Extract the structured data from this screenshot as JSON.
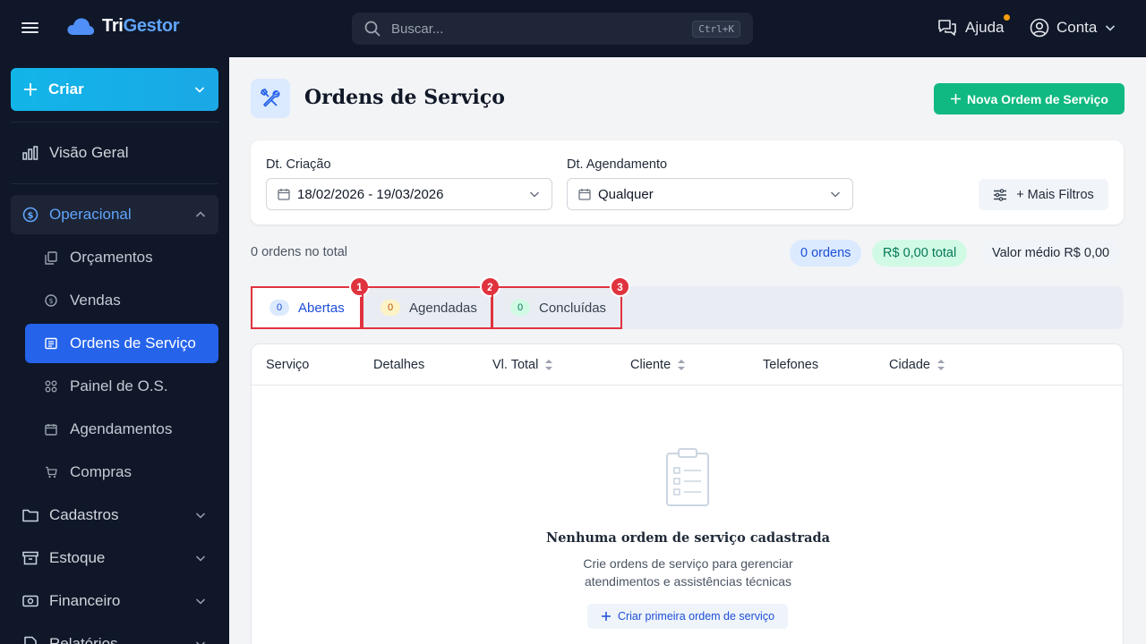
{
  "app": {
    "name_part1": "Tri",
    "name_part2": "Gestor"
  },
  "topbar": {
    "search_placeholder": "Buscar...",
    "search_shortcut": "Ctrl+K",
    "help_label": "Ajuda",
    "account_label": "Conta"
  },
  "sidebar": {
    "create_label": "Criar",
    "overview_label": "Visão Geral",
    "operational_label": "Operacional",
    "sub_items": [
      {
        "label": "Orçamentos"
      },
      {
        "label": "Vendas"
      },
      {
        "label": "Ordens de Serviço"
      },
      {
        "label": "Painel de O.S."
      },
      {
        "label": "Agendamentos"
      },
      {
        "label": "Compras"
      }
    ],
    "groups": [
      {
        "label": "Cadastros"
      },
      {
        "label": "Estoque"
      },
      {
        "label": "Financeiro"
      },
      {
        "label": "Relatórios"
      }
    ]
  },
  "page": {
    "title": "Ordens de Serviço",
    "new_button": "Nova Ordem de Serviço"
  },
  "filters": {
    "created_label": "Dt. Criação",
    "created_value": "18/02/2026 - 19/03/2026",
    "scheduled_label": "Dt. Agendamento",
    "scheduled_value": "Qualquer",
    "more_filters": "+ Mais Filtros"
  },
  "summary": {
    "total_text": "0 ordens no total",
    "orders_pill": "0 ordens",
    "total_pill": "R$ 0,00 total",
    "average_pill": "Valor médio R$ 0,00"
  },
  "tabs": [
    {
      "count": "0",
      "label": "Abertas",
      "badge": "1"
    },
    {
      "count": "0",
      "label": "Agendadas",
      "badge": "2"
    },
    {
      "count": "0",
      "label": "Concluídas",
      "badge": "3"
    }
  ],
  "table": {
    "columns": [
      "Serviço",
      "Detalhes",
      "Vl. Total",
      "Cliente",
      "Telefones",
      "Cidade"
    ]
  },
  "empty": {
    "title": "Nenhuma ordem de serviço cadastrada",
    "desc_line1": "Crie ordens de serviço para gerenciar",
    "desc_line2": "atendimentos e assistências técnicas",
    "cta": "Criar primeira ordem de serviço"
  },
  "colors": {
    "sidebar_bg": "#0f1729",
    "primary": "#2563eb",
    "success": "#10b981",
    "create": "#12b5e8",
    "highlight": "#e0333e"
  },
  "icons": [
    "menu-icon",
    "cloud-logo-icon",
    "search-icon",
    "help-chat-icon",
    "user-circle-icon",
    "chevron-down-icon",
    "plus-icon",
    "bar-chart-icon",
    "dollar-icon",
    "chevron-up-icon",
    "documents-icon",
    "coin-icon",
    "clipboard-list-icon",
    "grid-icon",
    "calendar-icon",
    "cart-icon",
    "folder-icon",
    "archive-icon",
    "money-icon",
    "report-icon",
    "tools-icon",
    "sliders-icon",
    "sort-icon"
  ]
}
